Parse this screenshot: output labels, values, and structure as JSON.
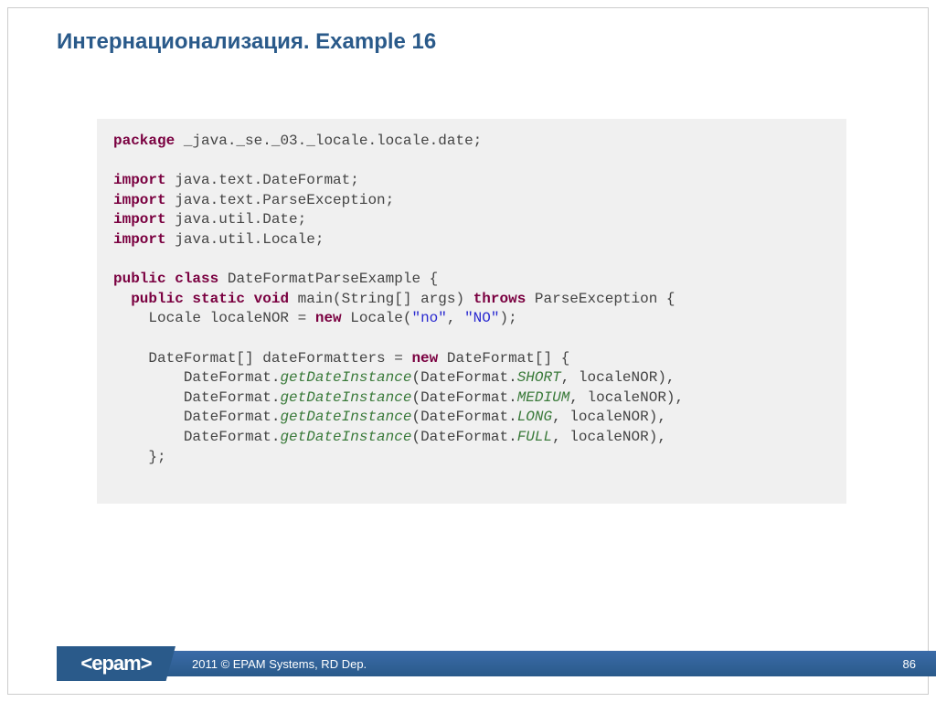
{
  "title": "Интернационализация. Example 16",
  "code": {
    "kw_package": "package",
    "pkg": " _java._se._03._locale.locale.date;",
    "kw_import": "import",
    "imp1": " java.text.DateFormat;",
    "imp2": " java.text.ParseException;",
    "imp3": " java.util.Date;",
    "imp4": " java.util.Locale;",
    "kw_public": "public",
    "kw_class": "class",
    "class_name": " DateFormatParseExample {",
    "kw_static": "static",
    "kw_void": "void",
    "main_sig": " main(String[] args) ",
    "kw_throws": "throws",
    "throws_rest": " ParseException {",
    "locale_decl_a": "    Locale localeNOR = ",
    "kw_new": "new",
    "locale_decl_b": " Locale(",
    "str_no": "\"no\"",
    "comma_sp": ", ",
    "str_NO": "\"NO\"",
    "locale_end": ");",
    "arr_decl_a": "    DateFormat[] dateFormatters = ",
    "arr_decl_b": " DateFormat[] {",
    "line_a": "        DateFormat.",
    "getDateInst": "getDateInstance",
    "line_b": "(DateFormat.",
    "c_short": "SHORT",
    "c_medium": "MEDIUM",
    "c_long": "LONG",
    "c_full": "FULL",
    "line_end": ", localeNOR),",
    "arr_close": "    };"
  },
  "footer": {
    "logo": "<epam>",
    "copyright": "2011 © EPAM Systems, RD Dep.",
    "page": "86"
  }
}
